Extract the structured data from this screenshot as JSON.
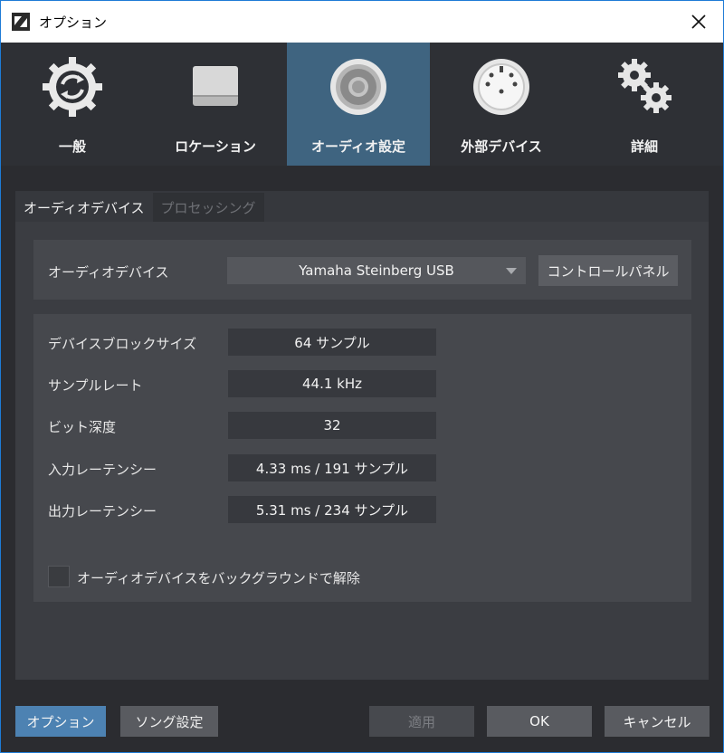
{
  "window": {
    "title": "オプション"
  },
  "categories": [
    {
      "label": "一般",
      "icon": "sync-gear-icon"
    },
    {
      "label": "ロケーション",
      "icon": "drive-icon"
    },
    {
      "label": "オーディオ設定",
      "icon": "speaker-icon",
      "active": true
    },
    {
      "label": "外部デバイス",
      "icon": "midi-port-icon"
    },
    {
      "label": "詳細",
      "icon": "gears-icon"
    }
  ],
  "subtabs": [
    {
      "label": "オーディオデバイス",
      "active": true
    },
    {
      "label": "プロセッシング",
      "active": false
    }
  ],
  "device": {
    "label": "オーディオデバイス",
    "selected": "Yamaha Steinberg USB",
    "control_panel_label": "コントロールパネル"
  },
  "info": [
    {
      "label": "デバイスブロックサイズ",
      "value": "64 サンプル"
    },
    {
      "label": "サンプルレート",
      "value": "44.1 kHz"
    },
    {
      "label": "ビット深度",
      "value": "32"
    },
    {
      "label": "入力レーテンシー",
      "value": "4.33 ms / 191 サンプル"
    },
    {
      "label": "出力レーテンシー",
      "value": "5.31 ms / 234 サンプル"
    }
  ],
  "release_checkbox": {
    "label": "オーディオデバイスをバックグラウンドで解除",
    "checked": false
  },
  "footer": {
    "options": "オプション",
    "song_settings": "ソング設定",
    "apply": "適用",
    "ok": "OK",
    "cancel": "キャンセル"
  },
  "colors": {
    "accent": "#4d82b2",
    "active_tab": "#3f6480",
    "window_border": "#1e7bd6"
  }
}
